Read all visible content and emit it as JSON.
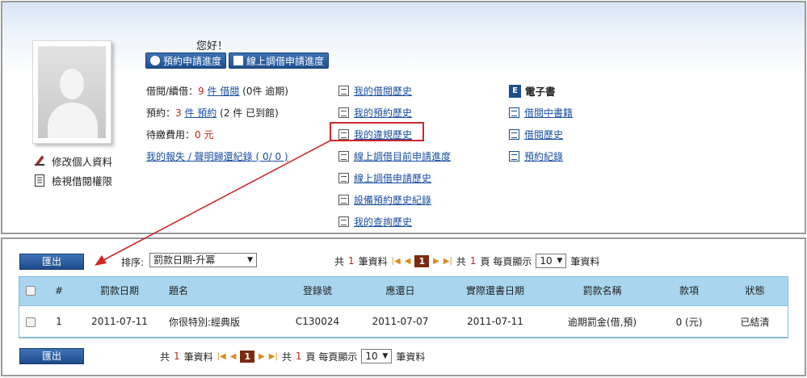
{
  "profile": {
    "edit_label": "修改個人資料",
    "permission_label": "檢視借閱權限"
  },
  "header": {
    "greeting": "您好！",
    "btn_reserve_progress": "預約申請進度",
    "btn_online_progress": "線上調借申請進度"
  },
  "stats": {
    "borrow_label": "借閱/續借：",
    "borrow_count": "9",
    "borrow_link": "件 借閱",
    "borrow_overdue_pre": "(0件 逾期)",
    "reserve_label": "預約：",
    "reserve_count": "3",
    "reserve_link": "件 預約",
    "reserve_arrived": "(2 件 已到館)",
    "fee_label": "待繳費用：",
    "fee_value": "0 元",
    "lost_link": "我的報失 / 聲明歸還紀錄 ( 0/ 0 )"
  },
  "history_links": [
    "我的借閱歷史",
    "我的預約歷史",
    "我的違規歷史",
    "線上調借目前申請進度",
    "線上調借申請歷史",
    "設備預約歷史紀錄",
    "我的查詢歷史"
  ],
  "ebook": {
    "title": "電子書",
    "icon_text": "E",
    "links": [
      "借閱中書籍",
      "借閱歷史",
      "預約紀錄"
    ]
  },
  "toolbar": {
    "export_label": "匯出",
    "sort_label": "排序:",
    "sort_value": "罰款日期-升冪"
  },
  "pager": {
    "total_pre": "共",
    "total_count": "1",
    "total_post": "筆資料",
    "current_page": "1",
    "pages_pre": "共",
    "pages_count": "1",
    "pages_post": "頁 每頁顯示",
    "per_page": "10",
    "per_page_post": "筆資料"
  },
  "table": {
    "headers": [
      "#",
      "罰款日期",
      "題名",
      "登錄號",
      "應還日",
      "實際還書日期",
      "罰款名稱",
      "款項",
      "狀態"
    ],
    "rows": [
      {
        "num": "1",
        "fine_date": "2011-07-11",
        "title": "你很特別:經典版",
        "barcode": "C130024",
        "due_date": "2011-07-07",
        "return_date": "2011-07-11",
        "fine_name": "逾期罰金(借,預)",
        "amount": "0 (元)",
        "status": "已結清"
      }
    ]
  },
  "colors": {
    "accent_blue": "#1f4f8f",
    "header_row": "#a9d6ee",
    "highlight_red": "#d1262a"
  }
}
